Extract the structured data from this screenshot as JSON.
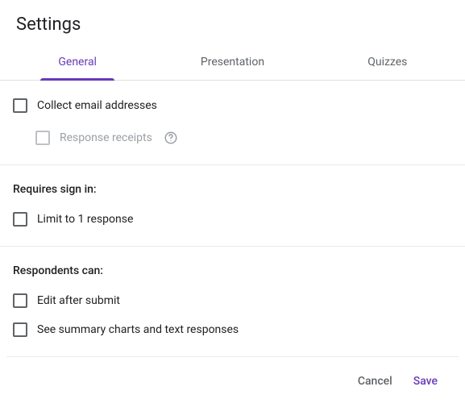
{
  "title": "Settings",
  "tabs": {
    "general": "General",
    "presentation": "Presentation",
    "quizzes": "Quizzes"
  },
  "section1": {
    "collect_email": "Collect email addresses",
    "response_receipts": "Response receipts"
  },
  "section2": {
    "heading": "Requires sign in:",
    "limit": "Limit to 1 response"
  },
  "section3": {
    "heading": "Respondents can:",
    "edit": "Edit after submit",
    "summary": "See summary charts and text responses"
  },
  "footer": {
    "cancel": "Cancel",
    "save": "Save"
  }
}
